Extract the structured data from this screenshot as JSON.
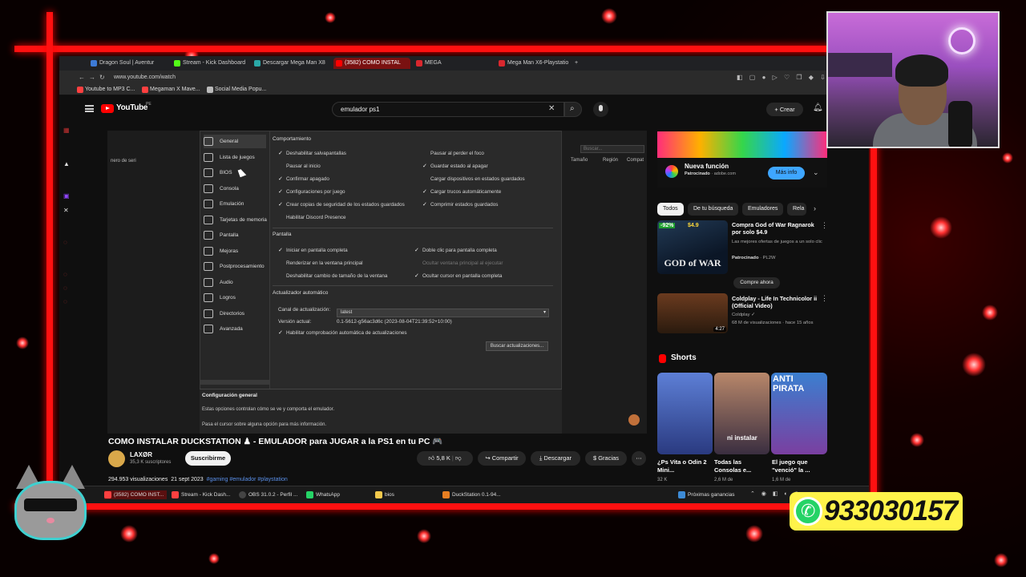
{
  "browser": {
    "tabs": [
      "Dragon Soul | Aventur",
      "Stream - Kick Dashboard",
      "Descargar Mega Man X8",
      "(3582) COMO INSTAL",
      "MEGA",
      "Mega Man X6-Playstatio"
    ],
    "url": "www.youtube.com/watch",
    "bookmarks": [
      "Youtube to MP3 C...",
      "Megaman X Mave...",
      "Social Media Popu..."
    ]
  },
  "youtube": {
    "logo_text": "YouTube",
    "country": "PE",
    "search_value": "emulador ps1",
    "create_label": "Crear"
  },
  "video": {
    "behind": {
      "serial": "nero de seri",
      "size": "Tamaño",
      "region": "Región",
      "compat": "Compat",
      "search": "Buscar..."
    },
    "settings": {
      "nav": [
        "General",
        "Lista de juegos",
        "BIOS",
        "Consola",
        "Emulación",
        "Tarjetas de memoria",
        "Pantalla",
        "Mejoras",
        "Postprocesamiento",
        "Audio",
        "Logros",
        "Directorios",
        "Avanzada"
      ],
      "behavior": {
        "title": "Comportamiento",
        "left": [
          "Deshabilitar salvapantallas",
          "Pausar al inicio",
          "Confirmar apagado",
          "Configuraciones por juego",
          "Crear copias de seguridad de los estados guardados",
          "Habilitar Discord Presence"
        ],
        "right": [
          "Pausar al perder el foco",
          "Guardar estado al apagar",
          "Cargar dispositivos en estados guardados",
          "Cargar trucos automáticamente",
          "Comprimir estados guardados"
        ]
      },
      "display": {
        "title": "Pantalla",
        "left": [
          "Iniciar en pantalla completa",
          "Renderizar en la ventana principal",
          "Deshabilitar cambio de tamaño de la ventana"
        ],
        "right": [
          "Doble clic para pantalla completa",
          "Ocultar ventana principal al ejecutar",
          "Ocultar cursor en pantalla completa"
        ]
      },
      "updater": {
        "title": "Actualizador automático",
        "channel_label": "Canal de actualización:",
        "channel_value": "latest",
        "version_label": "Versión actual:",
        "version_value": "0.1-5612-g56ac3d6c (2023-08-04T21:39:52+10:00)",
        "auto_check": "Habilitar comprobación automática de actualizaciones",
        "button": "Buscar actualizaciones..."
      },
      "description": {
        "title": "Configuración general",
        "line1": "Estas opciones controlan cómo se ve y comporta el emulador.",
        "line2": "Pasa el cursor sobre alguna opción para más información."
      }
    }
  },
  "video_info": {
    "title": "COMO INSTALAR DUCKSTATION ♟ - EMULADOR para JUGAR a la PS1 en tu PC 🎮",
    "channel": "LAXØR",
    "subscribers": "35,3 K suscriptores",
    "subscribe": "Suscribirme",
    "likes": "5,8 K",
    "share": "Compartir",
    "download": "Descargar",
    "thanks": "Gracias",
    "views": "294.953 visualizaciones",
    "date": "21 sept 2023",
    "tags": "#gaming #emulador #playstation"
  },
  "sidebar": {
    "ad": {
      "title": "Nueva función",
      "sponsored": "Patrocinado",
      "domain": "adobe.com",
      "button": "Más info"
    },
    "chips": [
      "Todos",
      "De tu búsqueda",
      "Emuladores",
      "Rela"
    ],
    "items": [
      {
        "discount": "-92%",
        "price": "$4.9",
        "title": "Compra God of War Ragnarok por solo $4.9",
        "desc": "Las mejores ofertas de juegos a un solo clic",
        "sponsored": "Patrocinado",
        "domain": "PL2W",
        "button": "Compre ahora"
      },
      {
        "title": "Coldplay - Life In Technicolor ii (Official Video)",
        "channel": "Coldplay ✓",
        "meta": "68 M de visualizaciones · hace 15 años",
        "duration": "4:27"
      }
    ],
    "shorts": {
      "heading": "Shorts",
      "items": [
        {
          "title": "¿Ps Vita o Odin 2 Mini...",
          "views": "32 K",
          "overlay": ""
        },
        {
          "title": "Todas las Consolas e...",
          "views": "2,6 M de",
          "overlay": "ni instalar"
        },
        {
          "title": "El juego que \"venció\" la ...",
          "views": "1,6 M de",
          "overlay": "ANTI PIRATA"
        }
      ]
    }
  },
  "taskbar": {
    "items": [
      "(3582) COMO INST...",
      "Stream - Kick Dash...",
      "OBS 31.0.2 - Perfil ...",
      "WhatsApp",
      "bios",
      "DuckStation 0.1-94..."
    ],
    "earnings": "Próximas ganancias"
  },
  "overlay": {
    "whatsapp": "933030157"
  }
}
